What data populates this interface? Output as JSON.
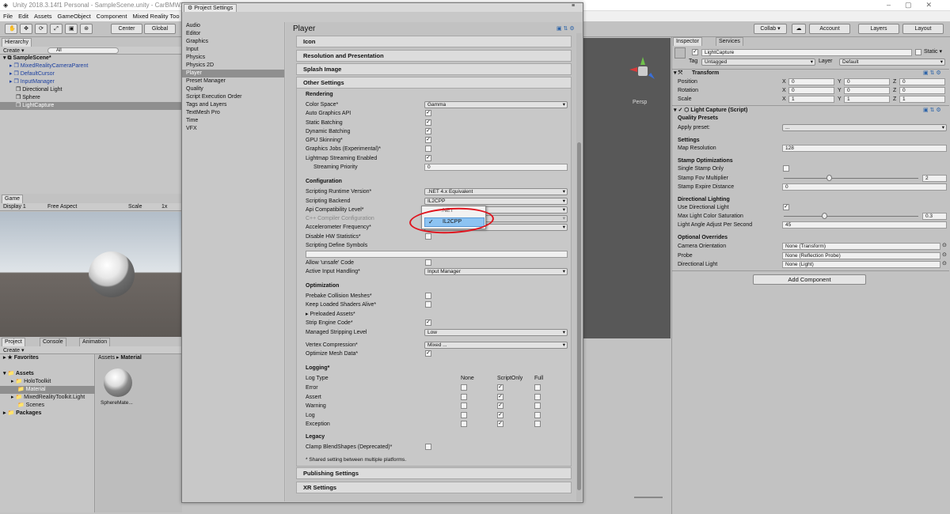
{
  "window": {
    "title": "Unity 2018.3.14f1 Personal - SampleScene.unity - CarBMWXSProje"
  },
  "menu": [
    "File",
    "Edit",
    "Assets",
    "GameObject",
    "Component",
    "Mixed Reality Too"
  ],
  "toolbar": {
    "center": "Center",
    "global": "Global",
    "collab": "Collab ▾",
    "account": "Account",
    "layers": "Layers",
    "layout": "Layout"
  },
  "hierarchy": {
    "tab": "Hierarchy",
    "create": "Create ▾",
    "search": "All",
    "scene": "SampleScene*",
    "items": [
      "MixedRealityCameraParent",
      "DefaultCursor",
      "InputManager",
      "Directional Light",
      "Sphere",
      "LightCapture"
    ]
  },
  "game": {
    "tab": "Game",
    "display": "Display 1",
    "aspect": "Free Aspect",
    "scale_label": "Scale",
    "scale_value": "1x"
  },
  "project": {
    "tab": "Project",
    "console": "Console",
    "animation": "Animation",
    "create": "Create ▾",
    "favorites": "Favorites",
    "assets": "Assets",
    "folders": [
      "HoloToolkit",
      "Material",
      "MixedRealityToolkit.Light",
      "Scenes"
    ],
    "packages": "Packages",
    "breadcrumb_root": "Assets",
    "breadcrumb_current": "Material",
    "asset_name": "SphereMate..."
  },
  "scene": {
    "persp": "Persp"
  },
  "settings": {
    "title": "Project Settings",
    "nav": [
      "Audio",
      "Editor",
      "Graphics",
      "Input",
      "Physics",
      "Physics 2D",
      "Player",
      "Preset Manager",
      "Quality",
      "Script Execution Order",
      "Tags and Layers",
      "TextMesh Pro",
      "Time",
      "VFX"
    ],
    "header": "Player",
    "sections": {
      "icon": "Icon",
      "resolution": "Resolution and Presentation",
      "splash": "Splash Image",
      "other": "Other Settings",
      "publishing": "Publishing Settings",
      "xr": "XR Settings"
    },
    "rendering": {
      "title": "Rendering",
      "color_space": "Color Space*",
      "color_space_value": "Gamma",
      "auto_graphics": "Auto Graphics API",
      "static_batching": "Static Batching",
      "dynamic_batching": "Dynamic Batching",
      "gpu_skinning": "GPU Skinning*",
      "graphics_jobs": "Graphics Jobs (Experimental)*",
      "lightmap_streaming": "Lightmap Streaming Enabled",
      "streaming_priority": "Streaming Priority",
      "streaming_priority_value": "0"
    },
    "configuration": {
      "title": "Configuration",
      "runtime": "Scripting Runtime Version*",
      "runtime_value": ".NET 4.x Equivalent",
      "backend": "Scripting Backend",
      "backend_value": "IL2CPP",
      "api": "Api Compatibility Level*",
      "cpp": "C++ Compiler Configuration",
      "accel": "Accelerometer Frequency*",
      "disable_hw": "Disable HW Statistics*",
      "define": "Scripting Define Symbols",
      "unsafe": "Allow 'unsafe' Code",
      "input_handling": "Active Input Handling*",
      "input_handling_value": "Input Manager"
    },
    "popup": {
      "net": ".NET",
      "il2cpp": "IL2CPP"
    },
    "optimization": {
      "title": "Optimization",
      "prebake": "Prebake Collision Meshes*",
      "keep_shaders": "Keep Loaded Shaders Alive*",
      "preloaded": "Preloaded Assets*",
      "strip": "Strip Engine Code*",
      "stripping": "Managed Stripping Level",
      "stripping_value": "Low",
      "vertex": "Vertex Compression*",
      "vertex_value": "Mixed ...",
      "mesh": "Optimize Mesh Data*"
    },
    "logging": {
      "title": "Logging*",
      "col_type": "Log Type",
      "col_none": "None",
      "col_script": "ScriptOnly",
      "col_full": "Full",
      "rows": [
        "Error",
        "Assert",
        "Warning",
        "Log",
        "Exception"
      ]
    },
    "legacy": {
      "title": "Legacy",
      "clamp": "Clamp BlendShapes (Deprecated)*",
      "note": "* Shared setting between multiple platforms."
    }
  },
  "inspector": {
    "tab": "Inspector",
    "services": "Services",
    "object": "LightCapture",
    "static": "Static ▾",
    "tag_label": "Tag",
    "tag_value": "Untagged",
    "layer_label": "Layer",
    "layer_value": "Default",
    "transform": {
      "title": "Transform",
      "position": "Position",
      "rotation": "Rotation",
      "scale": "Scale",
      "x": "X",
      "y": "Y",
      "z": "Z",
      "pos": [
        "0",
        "0",
        "0"
      ],
      "rot": [
        "0",
        "0",
        "0"
      ],
      "scl": [
        "1",
        "1",
        "1"
      ]
    },
    "script": {
      "title": "Light Capture (Script)",
      "quality": "Quality Presets",
      "apply": "Apply preset:",
      "apply_value": "...",
      "settings": "Settings",
      "map_res": "Map Resolution",
      "map_res_value": "128",
      "stamp": "Stamp Optimizations",
      "single": "Single Stamp Only",
      "fov": "Stamp Fov Multiplier",
      "fov_value": "2",
      "expire": "Stamp Expire Distance",
      "expire_value": "0",
      "dir": "Directional Lighting",
      "use_dir": "Use Directional Light",
      "max_sat": "Max Light Color Saturation",
      "max_sat_value": "0.3",
      "angle": "Light Angle Adjust Per Second",
      "angle_value": "45",
      "overrides": "Optional Overrides",
      "cam": "Camera Orientation",
      "cam_value": "None (Transform)",
      "probe": "Probe",
      "probe_value": "None (Reflection Probe)",
      "dlight": "Directional Light",
      "dlight_value": "None (Light)"
    },
    "add": "Add Component"
  },
  "colors": {
    "highlight": "#e0141e",
    "selected": "#3d8fe6"
  }
}
